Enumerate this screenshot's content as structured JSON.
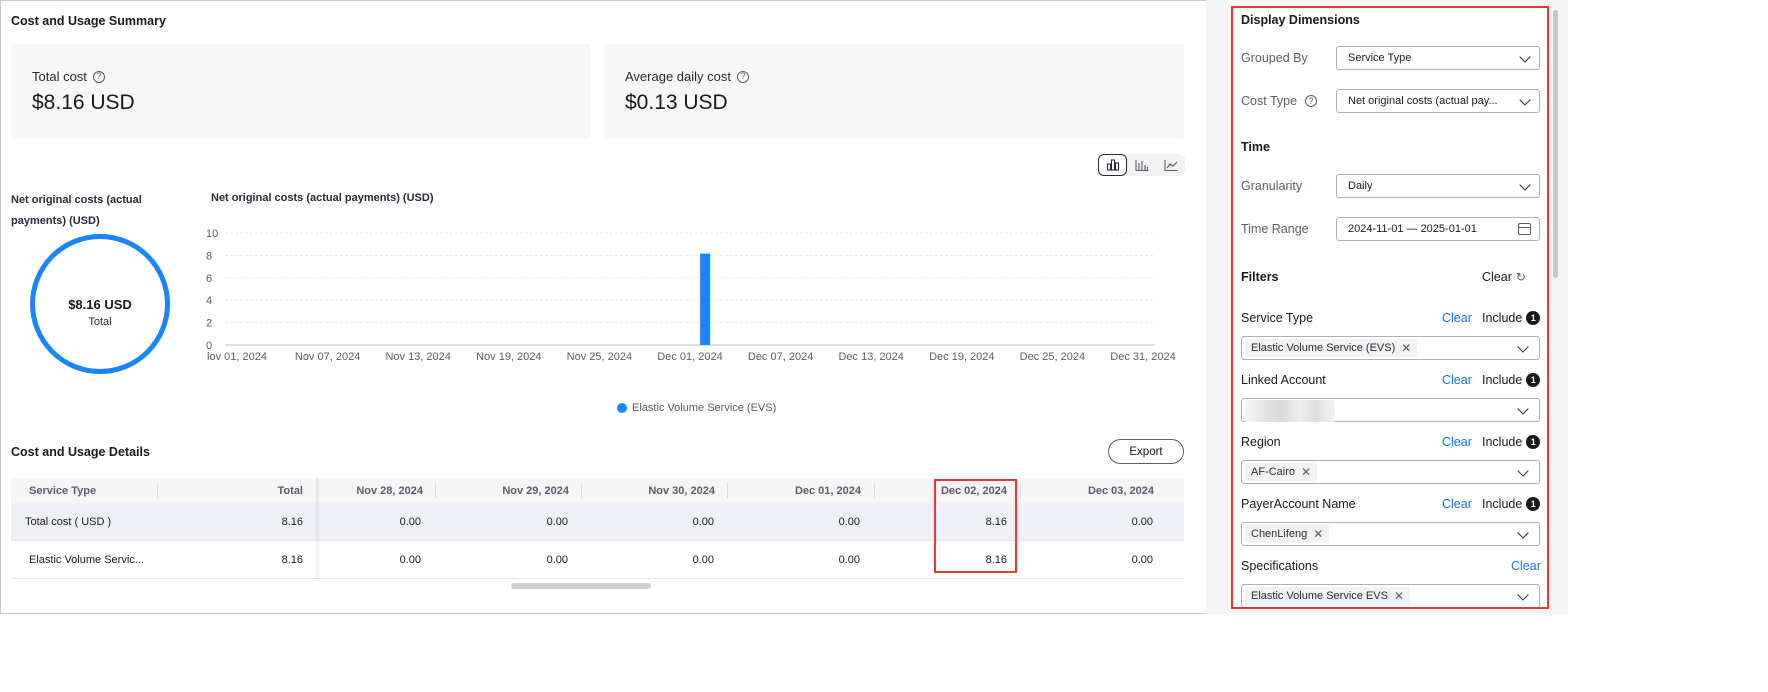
{
  "summary": {
    "title": "Cost and Usage Summary",
    "total_cost_label": "Total cost",
    "total_cost_value": "$8.16 USD",
    "avg_cost_label": "Average daily cost",
    "avg_cost_value": "$0.13 USD"
  },
  "donut": {
    "title": "Net original costs (actual payments) (USD)",
    "value": "$8.16 USD",
    "sub": "Total"
  },
  "chart_toggles": [
    "bar-chart-icon",
    "stacked-bar-chart-icon",
    "line-chart-icon"
  ],
  "chart_data": {
    "type": "bar",
    "title": "Net original costs (actual payments) (USD)",
    "xlabel": "",
    "ylabel": "",
    "ylim": [
      0,
      10
    ],
    "yticks": [
      "10",
      "8",
      "6",
      "4",
      "2",
      "0"
    ],
    "xticks": [
      "lov 01, 2024",
      "Nov 07, 2024",
      "Nov 13, 2024",
      "Nov 19, 2024",
      "Nov 25, 2024",
      "Dec 01, 2024",
      "Dec 07, 2024",
      "Dec 13, 2024",
      "Dec 19, 2024",
      "Dec 25, 2024",
      "Dec 31, 2024"
    ],
    "series": [
      {
        "name": "Elastic Volume Service (EVS)",
        "color": "#1a85ff",
        "points": [
          {
            "x": "Dec 02, 2024",
            "y": 8.16
          }
        ]
      }
    ]
  },
  "details": {
    "title": "Cost and Usage Details",
    "export_label": "Export",
    "columns": [
      "Service Type",
      "Total",
      "Nov 28, 2024",
      "Nov 29, 2024",
      "Nov 30, 2024",
      "Dec 01, 2024",
      "Dec 02, 2024",
      "Dec 03, 2024"
    ],
    "rows": [
      [
        "Total cost ( USD )",
        "8.16",
        "0.00",
        "0.00",
        "0.00",
        "0.00",
        "8.16",
        "0.00"
      ],
      [
        "Elastic Volume Servic...",
        "8.16",
        "0.00",
        "0.00",
        "0.00",
        "0.00",
        "8.16",
        "0.00"
      ]
    ]
  },
  "panel": {
    "display_title": "Display Dimensions",
    "grouped_by_label": "Grouped By",
    "grouped_by_value": "Service Type",
    "cost_type_label": "Cost Type",
    "cost_type_value": "Net original costs (actual pay...",
    "time_title": "Time",
    "granularity_label": "Granularity",
    "granularity_value": "Daily",
    "time_range_label": "Time Range",
    "time_range_value": "2024-11-01 — 2025-01-01",
    "filters_title": "Filters",
    "filters_clear": "Clear",
    "filters": [
      {
        "label": "Service Type",
        "clear": "Clear",
        "include": "Include",
        "badge": "1",
        "tag": "Elastic Volume Service (EVS)"
      },
      {
        "label": "Linked Account",
        "clear": "Clear",
        "include": "Include",
        "badge": "1",
        "tag": ""
      },
      {
        "label": "Region",
        "clear": "Clear",
        "include": "Include",
        "badge": "1",
        "tag": "AF-Cairo"
      },
      {
        "label": "PayerAccount Name",
        "clear": "Clear",
        "include": "Include",
        "badge": "1",
        "tag": "ChenLifeng"
      },
      {
        "label": "Specifications",
        "clear": "Clear",
        "tag": "Elastic Volume Service EVS"
      }
    ]
  }
}
